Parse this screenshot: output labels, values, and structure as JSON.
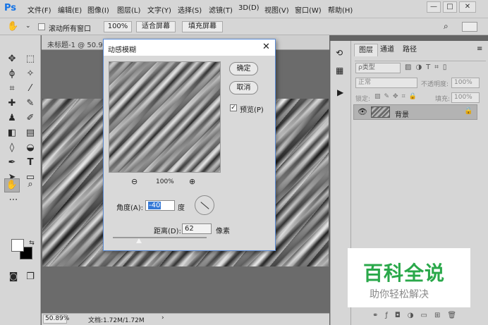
{
  "app": {
    "logo": "Ps"
  },
  "menu": [
    "文件(F)",
    "编辑(E)",
    "图像(I)",
    "图层(L)",
    "文字(Y)",
    "选择(S)",
    "滤镜(T)",
    "3D(D)",
    "视图(V)",
    "窗口(W)",
    "帮助(H)"
  ],
  "window_controls": {
    "minimize": "—",
    "restore": "□",
    "close": "✕"
  },
  "options": {
    "scroll_all_label": "滚动所有窗口",
    "zoom_100": "100%",
    "fit_screen": "适合屏幕",
    "fill_screen": "填充屏幕"
  },
  "document": {
    "tab_title": "未标题-1 @ 50.9",
    "zoom": "50.89%",
    "doc_info": "文档:1.72M/1.72M"
  },
  "dialog": {
    "title": "动感模糊",
    "ok": "确定",
    "cancel": "取消",
    "preview_label": "预览(P)",
    "preview_checked": true,
    "zoom_level": "100%",
    "angle_label": "角度(A):",
    "angle_value": "-40",
    "angle_unit": "度",
    "distance_label": "距离(D):",
    "distance_value": "62",
    "distance_unit": "像素"
  },
  "layers_panel": {
    "tabs": [
      "图层",
      "通道",
      "路径"
    ],
    "filter_kind": "ρ类型",
    "blend_mode": "正常",
    "opacity_label": "不透明度:",
    "opacity_value": "100%",
    "lock_label": "锁定:",
    "fill_label": "填充:",
    "fill_value": "100%",
    "layers": [
      {
        "name": "背景",
        "visible": true,
        "locked": true
      }
    ]
  },
  "watermark": {
    "title": "百科全说",
    "subtitle": "助你轻松解决"
  },
  "colors": {
    "accent": "#1473e6",
    "watermark_green": "#2aa84a"
  }
}
